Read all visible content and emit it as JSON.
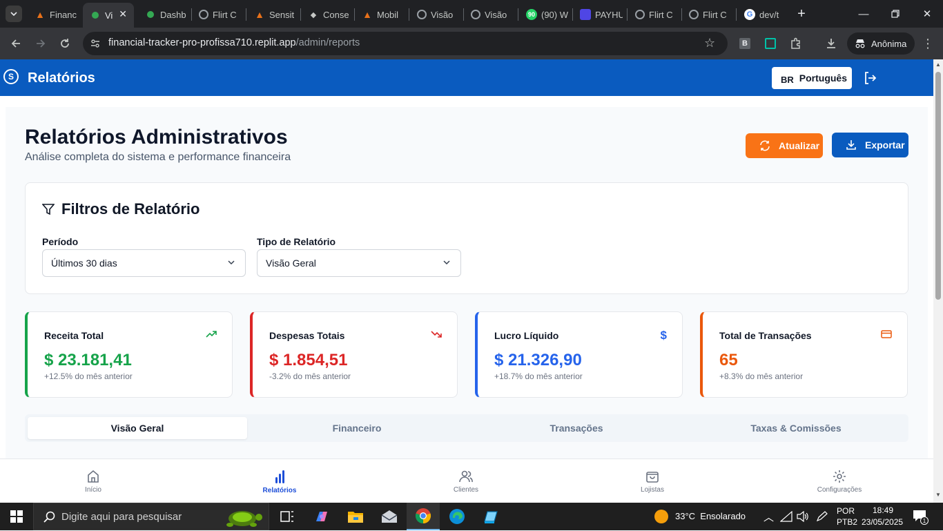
{
  "browser": {
    "tabs": [
      {
        "label": "Financ",
        "color": "#e8711a"
      },
      {
        "label": "Vi",
        "color": "#34a853",
        "active": true
      },
      {
        "label": "Dashb",
        "color": "#34a853"
      },
      {
        "label": "Flirt C",
        "color": "#9aa0a6"
      },
      {
        "label": "Sensit",
        "color": "#e8711a"
      },
      {
        "label": "Conse",
        "color": "#9aa0a6"
      },
      {
        "label": "Mobil",
        "color": "#e8711a"
      },
      {
        "label": "Visão",
        "color": "#9aa0a6"
      },
      {
        "label": "Visão",
        "color": "#9aa0a6"
      },
      {
        "label": "(90) W",
        "color": "#25d366",
        "badge": "90"
      },
      {
        "label": "PAYHU",
        "color": "#4f46e5"
      },
      {
        "label": "Flirt C",
        "color": "#9aa0a6"
      },
      {
        "label": "Flirt C",
        "color": "#9aa0a6"
      },
      {
        "label": "dev/t",
        "color": "#4285f4"
      }
    ],
    "url_host": "financial-tracker-pro-profissa710.replit.app",
    "url_path": "/admin/reports",
    "profile_label": "Anônima",
    "ext_b": "B"
  },
  "appbar": {
    "logo_text": "S",
    "title": "Relatórios",
    "lang_flag": "BR",
    "lang_label": "Português"
  },
  "page": {
    "title": "Relatórios Administrativos",
    "subtitle": "Análise completa do sistema e performance financeira",
    "refresh_label": "Atualizar",
    "export_label": "Exportar"
  },
  "filters": {
    "heading": "Filtros de Relatório",
    "period_label": "Período",
    "period_value": "Últimos 30 dias",
    "type_label": "Tipo de Relatório",
    "type_value": "Visão Geral"
  },
  "stats": [
    {
      "title": "Receita Total",
      "value": "$ 23.181,41",
      "sub": "+12.5% do mês anterior",
      "color": "#16a34a",
      "icon": "trending-up-icon"
    },
    {
      "title": "Despesas Totais",
      "value": "$ 1.854,51",
      "sub": "-3.2% do mês anterior",
      "color": "#dc2626",
      "icon": "trending-down-icon"
    },
    {
      "title": "Lucro Líquido",
      "value": "$ 21.326,90",
      "sub": "+18.7% do mês anterior",
      "color": "#2563eb",
      "icon": "dollar-icon"
    },
    {
      "title": "Total de Transações",
      "value": "65",
      "sub": "+8.3% do mês anterior",
      "color": "#ea580c",
      "icon": "credit-card-icon"
    }
  ],
  "report_tabs": [
    "Visão Geral",
    "Financeiro",
    "Transações",
    "Taxas & Comissões"
  ],
  "bottom_nav": [
    "Início",
    "Relatórios",
    "Clientes",
    "Lojistas",
    "Configurações"
  ],
  "taskbar": {
    "search_placeholder": "Digite aqui para pesquisar",
    "weather": "33°C  Ensolarado",
    "lang1": "POR",
    "lang2": "PTB2",
    "time": "18:49",
    "date": "23/05/2025",
    "notif_count": "1"
  }
}
